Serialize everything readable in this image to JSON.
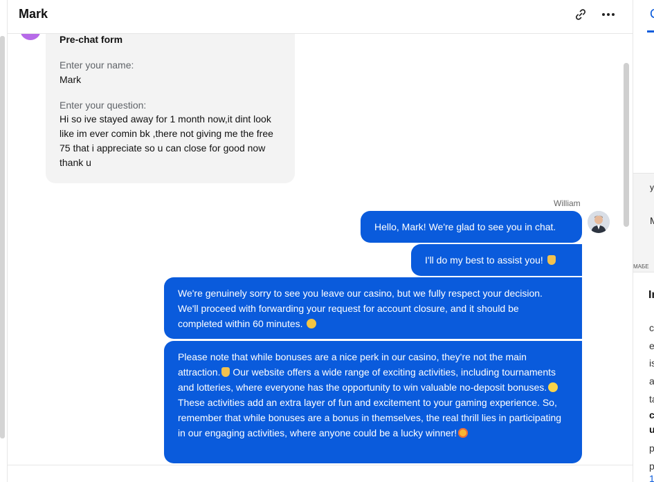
{
  "header": {
    "title": "Mark",
    "link_icon": "link-icon",
    "more_icon": "more-horizontal-icon"
  },
  "form": {
    "title": "Pre-chat form",
    "name_label": "Enter your name:",
    "name_value": "Mark",
    "question_label": "Enter your question:",
    "question_value": "Hi so ive stayed away for 1 month now,it dint look like im ever comin bk ,there not giving me the free 75 that i appreciate so u can close for good now thank u"
  },
  "agent": {
    "name": "William"
  },
  "messages": [
    {
      "text": "Hello, Mark! We're glad to see you in chat.",
      "emoji": ""
    },
    {
      "text": "I'll do my best to assist you! ",
      "emoji": "folded-hands"
    },
    {
      "text": "We're genuinely sorry to see you leave our casino, but we fully respect your decision. We'll proceed with forwarding your request for account closure, and it should be completed within 60 minutes. ",
      "emoji": "sad-face"
    },
    {
      "text_parts": [
        "Please note that while bonuses are a nice perk in our casino, they're not the main attraction.",
        " Our website offers a wide range of exciting activities, including tournaments and lotteries, where everyone has the opportunity to win valuable no-deposit bonuses.",
        " These activities add an extra layer of fun and excitement to your gaming experience. So, remember that while bonuses are a bonus in themselves, the real thrill lies in participating in our engaging activities, where anyone could be a lucky winner!"
      ],
      "emojis": [
        "folded-hands",
        "smiling-face",
        "star-struck-face"
      ]
    }
  ],
  "right_panel": {
    "tab_letter": "C",
    "map_label_1": "у",
    "map_label_2": "M",
    "map_label_3": "МАБЕ",
    "heading": "In",
    "lines": [
      "c",
      "e",
      "is",
      "a",
      "ta",
      "c",
      "u",
      "p",
      "p",
      "1"
    ]
  }
}
